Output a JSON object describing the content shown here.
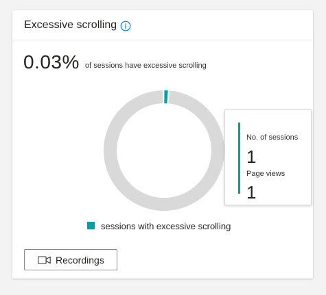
{
  "card": {
    "title": "Excessive scrolling",
    "info_icon": "info-icon"
  },
  "metric": {
    "value": "0.03%",
    "description": "of sessions have excessive scrolling"
  },
  "chart_data": {
    "type": "pie",
    "style": "donut",
    "slices": [
      {
        "label": "sessions with excessive scrolling",
        "value": 0.03,
        "color": "#00a0a8"
      },
      {
        "label": "",
        "value": 99.97,
        "color": "#d9d9d9"
      }
    ],
    "legend": [
      "sessions with excessive scrolling"
    ],
    "legend_placement": "bottom"
  },
  "tooltip": {
    "sessions_label": "No. of sessions",
    "sessions_value": "1",
    "pageviews_label": "Page views",
    "pageviews_value": "1",
    "accent_color": "#00a0a8"
  },
  "legend": {
    "label": "sessions with excessive scrolling",
    "color": "#00a0a8"
  },
  "actions": {
    "recordings_label": "Recordings",
    "recordings_icon": "video-camera-icon"
  }
}
